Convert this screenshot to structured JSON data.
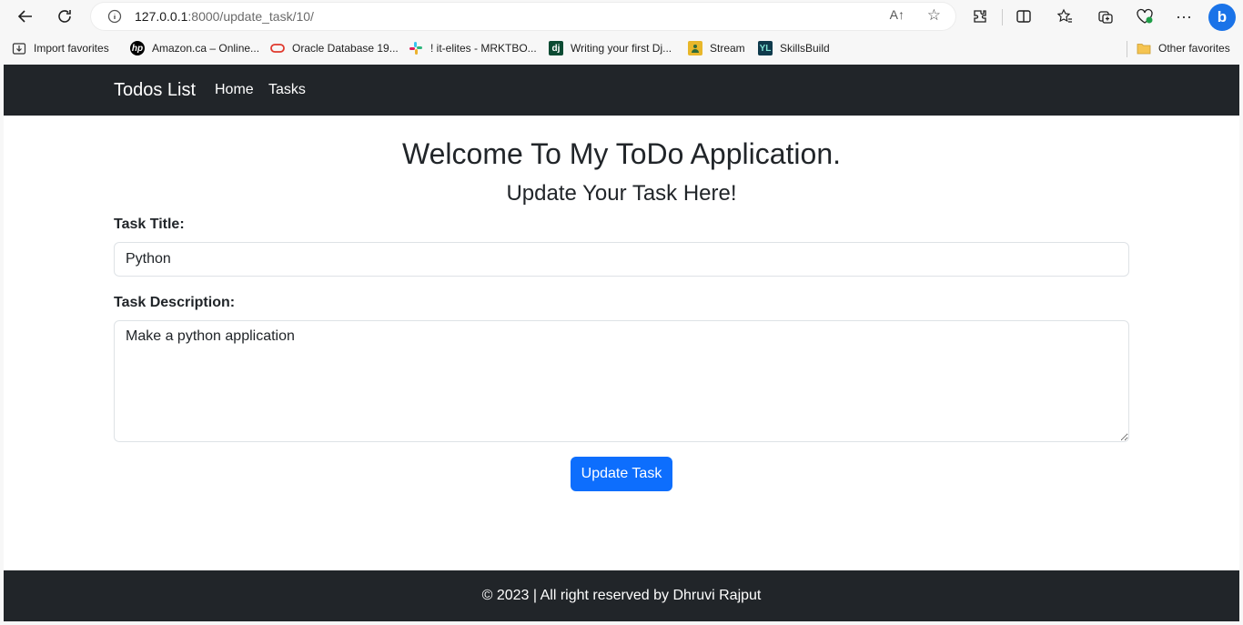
{
  "browser": {
    "url_host": "127.0.0.1",
    "url_path": ":8000/update_task/10/",
    "read_aloud_label": "A↑",
    "bing_label": "b"
  },
  "bookmarks": [
    {
      "label": "Import favorites",
      "icon": "import-icon"
    },
    {
      "label": "Amazon.ca – Online...",
      "icon": "hp-icon"
    },
    {
      "label": "Oracle Database 19...",
      "icon": "oracle-icon"
    },
    {
      "label": "! it-elites - MRKTBO...",
      "icon": "slack-icon"
    },
    {
      "label": "Writing your first Dj...",
      "icon": "django-icon"
    },
    {
      "label": "Stream",
      "icon": "stream-icon"
    },
    {
      "label": "SkillsBuild",
      "icon": "skillsbuild-icon"
    },
    {
      "label": "Other favorites",
      "icon": "folder-icon"
    }
  ],
  "navbar": {
    "brand": "Todos List",
    "links": [
      "Home",
      "Tasks"
    ]
  },
  "main": {
    "heading": "Welcome To My ToDo Application.",
    "subheading": "Update Your Task Here!",
    "title_label": "Task Title:",
    "title_value": "Python",
    "description_label": "Task Description:",
    "description_value": "Make a python application",
    "submit_label": "Update Task"
  },
  "footer": {
    "text": "© 2023 | All right reserved by Dhruvi Rajput"
  },
  "colors": {
    "navbar_bg": "#212529",
    "button_bg": "#0d6efd"
  }
}
